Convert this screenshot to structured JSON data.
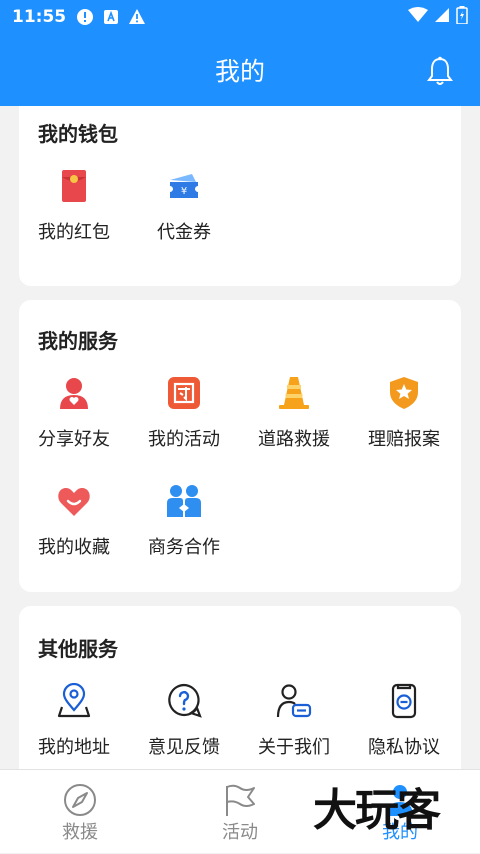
{
  "status_bar": {
    "time": "11:55",
    "icons": [
      "alert-circle-icon",
      "a-box-icon",
      "warning-icon",
      "wifi-icon",
      "signal-icon",
      "battery-charging-icon"
    ]
  },
  "header": {
    "title": "我的",
    "bell_icon": "bell-icon"
  },
  "wallet": {
    "title": "我的钱包",
    "items": [
      {
        "label": "我的红包",
        "icon": "red-packet-icon"
      },
      {
        "label": "代金券",
        "icon": "voucher-icon"
      }
    ]
  },
  "services": {
    "title": "我的服务",
    "items": [
      {
        "label": "分享好友",
        "icon": "share-friend-icon"
      },
      {
        "label": "我的活动",
        "icon": "my-activity-icon"
      },
      {
        "label": "道路救援",
        "icon": "traffic-cone-icon"
      },
      {
        "label": "理赔报案",
        "icon": "claim-shield-icon"
      },
      {
        "label": "我的收藏",
        "icon": "heart-icon"
      },
      {
        "label": "商务合作",
        "icon": "cooperation-icon"
      }
    ]
  },
  "other": {
    "title": "其他服务",
    "items": [
      {
        "label": "我的地址",
        "icon": "location-pin-icon"
      },
      {
        "label": "意见反馈",
        "icon": "feedback-icon"
      },
      {
        "label": "关于我们",
        "icon": "about-user-icon"
      },
      {
        "label": "隐私协议",
        "icon": "privacy-doc-icon"
      }
    ]
  },
  "tabbar": {
    "tabs": [
      {
        "label": "救援",
        "icon": "compass-icon",
        "active": false
      },
      {
        "label": "活动",
        "icon": "flag-icon",
        "active": false
      },
      {
        "label": "我的",
        "icon": "person-icon",
        "active": true
      }
    ]
  },
  "watermark": {
    "text": "大玩客"
  },
  "colors": {
    "primary": "#1e90ff",
    "card": "#ffffff",
    "background": "#f2f2f2"
  }
}
